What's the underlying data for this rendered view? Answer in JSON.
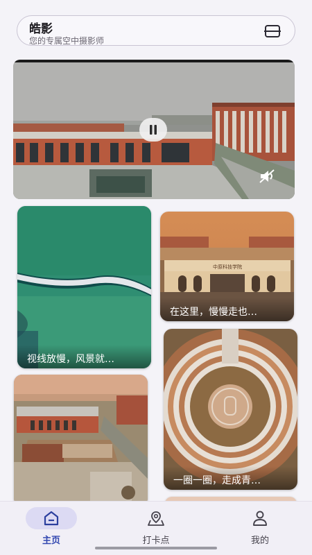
{
  "header": {
    "title": "皓影",
    "subtitle": "您的专属空中摄影师",
    "action_icon": "scan-icon"
  },
  "hero_video": {
    "state": "playing",
    "pause_icon": "pause-icon",
    "mute_icon": "muted-speaker-icon"
  },
  "gallery": {
    "items": [
      {
        "caption": "视线放慢，风景就…",
        "scene": "green water with bridge"
      },
      {
        "caption": "在这里，慢慢走也…",
        "scene": "university gate at sunset"
      },
      {
        "caption": "一圈一圈，走成青…",
        "scene": "circular amphitheater"
      },
      {
        "caption": "",
        "scene": "campus buildings aerial"
      }
    ],
    "gate_sign": "中原科技学院"
  },
  "bottom_nav": {
    "items": [
      {
        "label": "主页",
        "icon": "home-icon",
        "active": true
      },
      {
        "label": "打卡点",
        "icon": "map-pin-icon",
        "active": false
      },
      {
        "label": "我的",
        "icon": "person-icon",
        "active": false
      }
    ]
  },
  "colors": {
    "accent": "#3247b0",
    "active_pill": "#dcdaf3",
    "background": "#f4f3f8"
  }
}
